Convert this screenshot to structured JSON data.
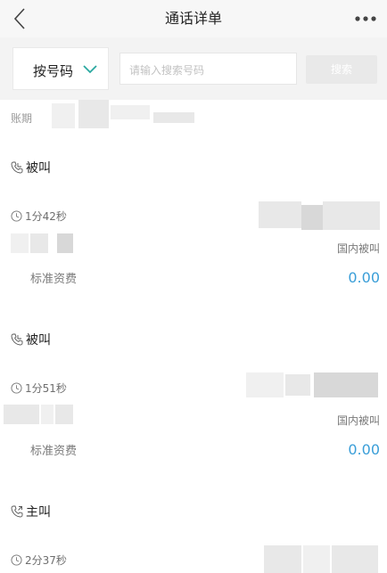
{
  "header": {
    "title": "通话详单",
    "back_icon": "chevron-left-icon",
    "more_icon": "more-horizontal-icon"
  },
  "search": {
    "mode_label": "按号码",
    "placeholder": "请输入搜索号码",
    "button_label": "搜索"
  },
  "period_label": "账期",
  "records": [
    {
      "type": "被叫",
      "duration": "1分42秒",
      "kind": "国内被叫",
      "fee_label": "标准资费",
      "fee": "0.00"
    },
    {
      "type": "被叫",
      "duration": "1分51秒",
      "kind": "国内被叫",
      "fee_label": "标准资费",
      "fee": "0.00"
    },
    {
      "type": "主叫",
      "duration": "2分37秒"
    }
  ],
  "colors": {
    "accent_blue": "#3a9ed8",
    "chevron_teal": "#2aa8a0",
    "header_bg": "#f7f7f7",
    "searchbar_bg": "#f3f3f3"
  }
}
